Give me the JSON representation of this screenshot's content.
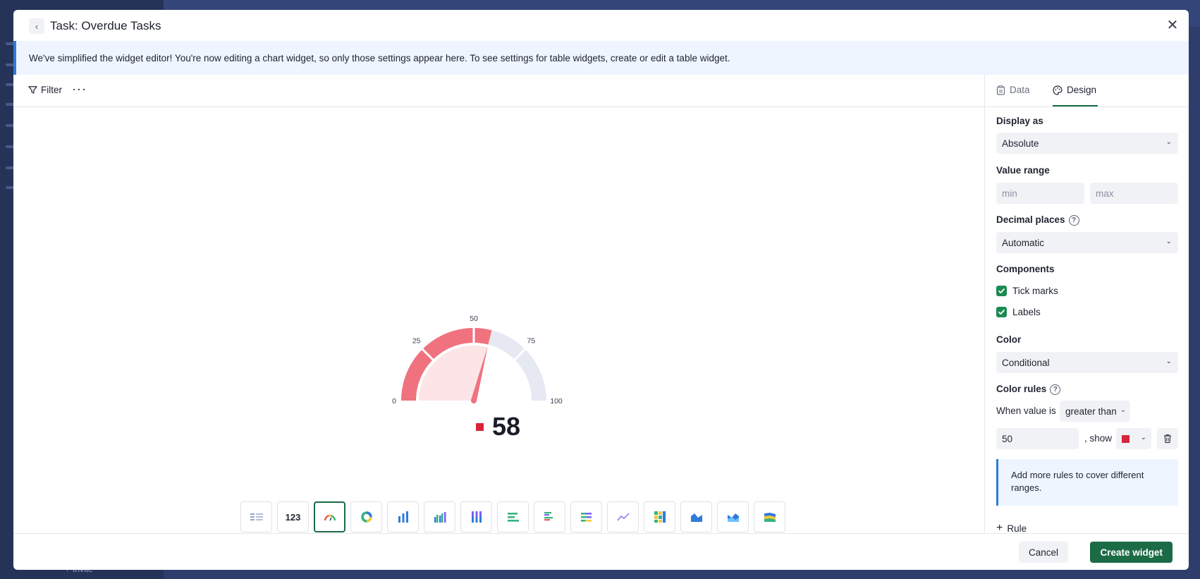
{
  "background": {
    "invite_label": "Invite"
  },
  "modal": {
    "title": "Task: Overdue Tasks",
    "banner": "We've simplified the widget editor! You're now editing a chart widget, so only those settings appear here. To see settings for table widgets, create or edit a table widget."
  },
  "toolbar": {
    "filter_label": "Filter",
    "more_label": "···"
  },
  "gauge": {
    "value": "58",
    "value_number": 58,
    "min": 0,
    "max": 100,
    "tick_labels": [
      "0",
      "25",
      "50",
      "75",
      "100"
    ],
    "threshold": 50,
    "colors": {
      "filled": "#f0727f",
      "inner": "#fde4e6",
      "remaining": "#e6e9f2",
      "needle": "#f0727f",
      "swatch": "#d8243a"
    }
  },
  "chart_types": [
    {
      "name": "table-chart-icon",
      "label": ""
    },
    {
      "name": "number-chart-icon",
      "label": "123"
    },
    {
      "name": "gauge-chart-icon",
      "label": ""
    },
    {
      "name": "donut-chart-icon",
      "label": ""
    },
    {
      "name": "bar-chart-icon",
      "label": ""
    },
    {
      "name": "grouped-bar-chart-icon",
      "label": ""
    },
    {
      "name": "stacked-bar-chart-icon",
      "label": ""
    },
    {
      "name": "horizontal-bar-chart-icon",
      "label": ""
    },
    {
      "name": "horizontal-grouped-bar-chart-icon",
      "label": ""
    },
    {
      "name": "horizontal-stacked-bar-chart-icon",
      "label": ""
    },
    {
      "name": "line-chart-icon",
      "label": ""
    },
    {
      "name": "heatmap-chart-icon",
      "label": ""
    },
    {
      "name": "area-chart-icon",
      "label": ""
    },
    {
      "name": "multi-area-chart-icon",
      "label": ""
    },
    {
      "name": "stacked-area-chart-icon",
      "label": ""
    }
  ],
  "tabs": {
    "data": "Data",
    "design": "Design"
  },
  "design": {
    "display_as_label": "Display as",
    "display_as_value": "Absolute",
    "value_range_label": "Value range",
    "min_placeholder": "min",
    "max_placeholder": "max",
    "decimal_label": "Decimal places",
    "decimal_value": "Automatic",
    "components_label": "Components",
    "tick_marks_label": "Tick marks",
    "labels_label": "Labels",
    "color_label": "Color",
    "color_value": "Conditional",
    "color_rules_label": "Color rules",
    "when_value_label": "When value is",
    "operator": "greater than",
    "rule_value": "50",
    "show_label": ", show",
    "rule_color": "#d8243a",
    "info_text": "Add more rules to cover different ranges.",
    "add_rule_label": "Rule"
  },
  "footer": {
    "cancel": "Cancel",
    "create": "Create widget"
  }
}
